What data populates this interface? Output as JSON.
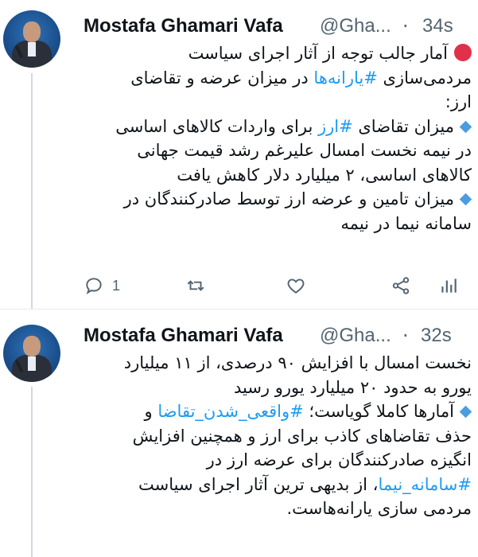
{
  "tweets": [
    {
      "author_name": "Mostafa Ghamari Vafa",
      "handle": "@Gha...",
      "separator": "·",
      "time": "34s",
      "lines": [
        "آمار جالب توجه از آثار اجرای سیاست",
        [
          "مردمی‌سازی ",
          "#یارانه‌ها",
          " در میزان عرضه و تقاضای"
        ],
        "ارز:",
        [
          "میزان تقاضای ",
          "#ارز",
          " برای واردات کالاهای اساسی"
        ],
        "در نیمه نخست امسال علیرغم رشد قیمت جهانی",
        "کالاهای اساسی، ۲ میلیارد دلار کاهش یافت",
        "میزان تامین و عرضه ارز توسط صادرکنندگان در",
        "سامانه نیما در نیمه"
      ],
      "reply_count": "1",
      "icons": [
        "reply-icon",
        "retweet-icon",
        "like-icon",
        "share-icon",
        "analytics-icon"
      ]
    },
    {
      "author_name": "Mostafa Ghamari Vafa",
      "handle": "@Gha...",
      "separator": "·",
      "time": "32s",
      "lines": [
        "نخست امسال با افزایش ۹۰ درصدی، از ۱۱ میلیارد",
        "یورو به حدود ۲۰ میلیارد یورو رسید",
        [
          "آمارها کاملا گویاست؛ ",
          "#واقعی_شدن_تقاضا",
          " و"
        ],
        "حذف تقاضاهای کاذب برای ارز و همچنین افزایش",
        "انگیزه صادرکنندگان برای عرضه ارز در",
        [
          "#سامانه_نیما",
          "، از بدیهی ترین آثار اجرای سیاست"
        ],
        "مردمی سازی یارانه‌هاست."
      ]
    }
  ],
  "colors": {
    "text": "#0f1419",
    "secondary": "#536471",
    "hashtag": "#1d9bf0",
    "red_circle": "#e0304a",
    "blue_diamond": "#4a9de0"
  }
}
